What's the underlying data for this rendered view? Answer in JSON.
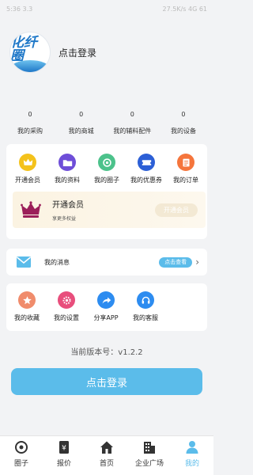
{
  "status_bar": {
    "time": "5:36 3.3",
    "right": "27.5K/s 4G 61"
  },
  "header": {
    "logo_text": "化纤圈",
    "logo_sub": "HuaXianQuan",
    "login_text": "点击登录"
  },
  "stats": [
    {
      "value": "0",
      "label": "我的采购"
    },
    {
      "value": "0",
      "label": "我的商城"
    },
    {
      "value": "0",
      "label": "我的辅料配件"
    },
    {
      "value": "0",
      "label": "我的设备"
    }
  ],
  "services": [
    {
      "label": "开通会员",
      "icon": "crown-icon",
      "color": "#f4c21b"
    },
    {
      "label": "我的资料",
      "icon": "folder-icon",
      "color": "#6e4ed8"
    },
    {
      "label": "我的圈子",
      "icon": "circle-icon",
      "color": "#4cc28b"
    },
    {
      "label": "我的优惠券",
      "icon": "coupon-icon",
      "color": "#2c5fd6"
    },
    {
      "label": "我的订单",
      "icon": "order-icon",
      "color": "#f5753c"
    }
  ],
  "vip": {
    "title": "开通会员",
    "subtitle": "享更多权益",
    "button": "开通会员",
    "crown_color": "#9b1f5a"
  },
  "messages": {
    "label": "我的消息",
    "button": "点击查看"
  },
  "tools": [
    {
      "label": "我的收藏",
      "icon": "star-icon",
      "color": "#f08c6c"
    },
    {
      "label": "我的设置",
      "icon": "settings-icon",
      "color": "#e84e7c"
    },
    {
      "label": "分享APP",
      "icon": "share-icon",
      "color": "#2d8cf0"
    },
    {
      "label": "我的客服",
      "icon": "headset-icon",
      "color": "#2d8cf0"
    }
  ],
  "version": "当前版本号：v1.2.2",
  "login_button": "点击登录",
  "tabs": [
    {
      "label": "圈子",
      "icon": "circle-tab-icon",
      "active": false
    },
    {
      "label": "报价",
      "icon": "price-tab-icon",
      "active": false
    },
    {
      "label": "首页",
      "icon": "home-tab-icon",
      "active": false
    },
    {
      "label": "企业广场",
      "icon": "building-tab-icon",
      "active": false
    },
    {
      "label": "我的",
      "icon": "user-tab-icon",
      "active": true
    }
  ],
  "colors": {
    "accent": "#5bbcea",
    "background": "#f2f3f5",
    "brand": "#1f78c8"
  }
}
